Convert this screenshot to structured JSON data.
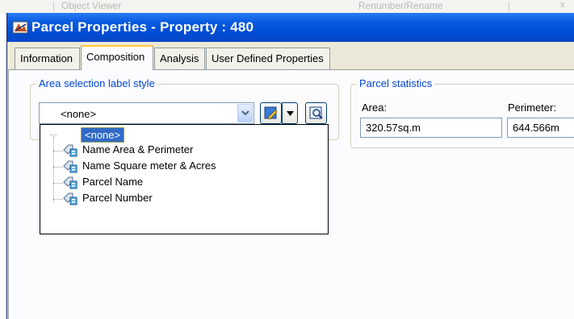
{
  "background_window": {
    "left_text": "Object Viewer",
    "mid_text": "Renumber/Rename",
    "close_glyph": "x"
  },
  "dialog": {
    "title": "Parcel Properties - Property : 480",
    "title_icon": "parcel-app-icon",
    "title_bar_color": "#0050d8"
  },
  "tabs": [
    {
      "label": "Information",
      "active": false
    },
    {
      "label": "Composition",
      "active": true
    },
    {
      "label": "Analysis",
      "active": false
    },
    {
      "label": "User Defined Properties",
      "active": false
    }
  ],
  "area_label_style": {
    "group_label": "Area selection label style",
    "selected_value": "<none>",
    "options": [
      {
        "label": "<none>",
        "selected": true,
        "icon": null
      },
      {
        "label": "Name Area & Perimeter",
        "selected": false,
        "icon": "label-style-icon"
      },
      {
        "label": "Name Square meter & Acres",
        "selected": false,
        "icon": "label-style-icon"
      },
      {
        "label": "Parcel Name",
        "selected": false,
        "icon": "label-style-icon"
      },
      {
        "label": "Parcel Number",
        "selected": false,
        "icon": "label-style-icon"
      }
    ]
  },
  "parcel_statistics": {
    "group_label": "Parcel statistics",
    "area_label": "Area:",
    "area_value": "320.57sq.m",
    "perimeter_label": "Perimeter:",
    "perimeter_value": "644.566m"
  },
  "colors": {
    "group_label": "#0046d5",
    "selection": "#316ac5",
    "active_tab_highlight": "#ffc83c"
  }
}
